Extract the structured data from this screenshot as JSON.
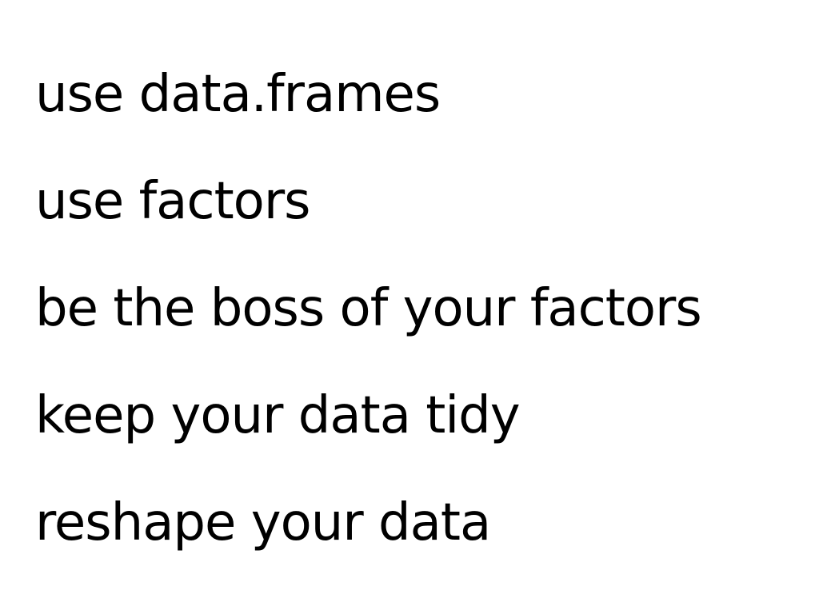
{
  "slide": {
    "bullets": [
      "use data.frames",
      "use factors",
      "be the boss of your factors",
      "keep your data tidy",
      "reshape your data"
    ]
  },
  "colors": {
    "background": "#ffffff",
    "text": "#000000"
  }
}
